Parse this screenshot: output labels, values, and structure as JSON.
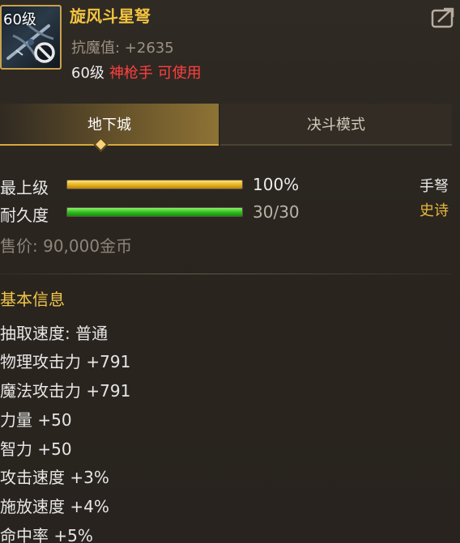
{
  "item": {
    "icon_level": "60级",
    "name": "旋风斗星弩",
    "anti_magic": "抗魔值: +2635",
    "req_level": "60级",
    "req_class": "神枪手 可使用",
    "icons": {
      "item": "crossbow-icon",
      "forbid": "forbidden-icon",
      "share": "share-icon"
    }
  },
  "tabs": [
    {
      "label": "地下城",
      "active": true
    },
    {
      "label": "决斗模式",
      "active": false
    }
  ],
  "stats": {
    "grade_label": "最上级",
    "grade_value": "100%",
    "grade_fraction": 1.0,
    "durability_label": "耐久度",
    "durability_value": "30/30",
    "durability_fraction": 1.0,
    "weapon_type": "手弩",
    "rarity": "史诗",
    "price": "售价: 90,000金币"
  },
  "basic_info": {
    "title": "基本信息",
    "attributes": [
      "抽取速度: 普通",
      "物理攻击力 +791",
      "魔法攻击力 +791",
      "力量 +50",
      "智力 +50",
      "攻击速度 +3%",
      "施放速度 +4%",
      "命中率 +5%"
    ]
  },
  "colors": {
    "name_gold": "#f2c440",
    "class_red": "#ff4040",
    "rarity_gold": "#e9b83c",
    "bar_gold": "#e6b21e",
    "bar_green": "#2dbb1c"
  }
}
